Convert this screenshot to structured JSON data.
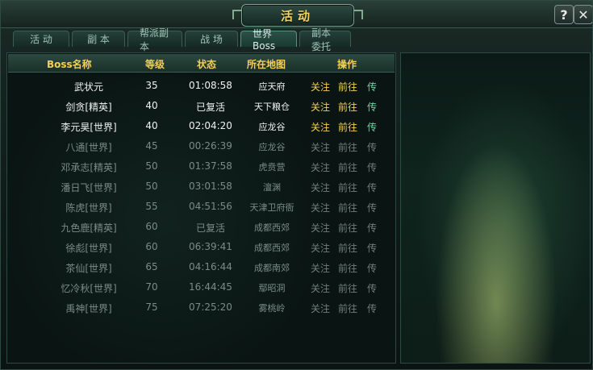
{
  "window": {
    "title": "活动",
    "help_label": "?",
    "close_label": "✕"
  },
  "tabs": [
    {
      "label": "活  动"
    },
    {
      "label": "副  本"
    },
    {
      "label": "帮派副本"
    },
    {
      "label": "战  场"
    },
    {
      "label": "世界Boss"
    },
    {
      "label": "副本委托"
    }
  ],
  "table": {
    "headers": [
      "Boss名称",
      "等级",
      "状态",
      "所在地图",
      "操作"
    ],
    "actions": {
      "follow": "关注",
      "go": "前往",
      "teleport": "传"
    },
    "rows": [
      {
        "name": "武状元",
        "level": "35",
        "status": "01:08:58",
        "map": "应天府"
      },
      {
        "name": "剑贪[精英]",
        "level": "40",
        "status": "已复活",
        "map": "天下粮仓"
      },
      {
        "name": "李元昊[世界]",
        "level": "40",
        "status": "02:04:20",
        "map": "应龙谷"
      },
      {
        "name": "八通[世界]",
        "level": "45",
        "status": "00:26:39",
        "map": "应龙谷"
      },
      {
        "name": "邓承志[精英]",
        "level": "50",
        "status": "01:37:58",
        "map": "虎贲营"
      },
      {
        "name": "潘日飞[世界]",
        "level": "50",
        "status": "03:01:58",
        "map": "澶渊"
      },
      {
        "name": "陈虎[世界]",
        "level": "55",
        "status": "04:51:56",
        "map": "天津卫府衙"
      },
      {
        "name": "九色鹿[精英]",
        "level": "60",
        "status": "已复活",
        "map": "成都西郊"
      },
      {
        "name": "徐彪[世界]",
        "level": "60",
        "status": "06:39:41",
        "map": "成都西郊"
      },
      {
        "name": "茶仙[世界]",
        "level": "65",
        "status": "04:16:44",
        "map": "成都南郊"
      },
      {
        "name": "忆冷秋[世界]",
        "level": "70",
        "status": "16:44:45",
        "map": "鄢昭洞"
      },
      {
        "name": "禹神[世界]",
        "level": "75",
        "status": "07:25:20",
        "map": "雾桃岭"
      }
    ]
  }
}
